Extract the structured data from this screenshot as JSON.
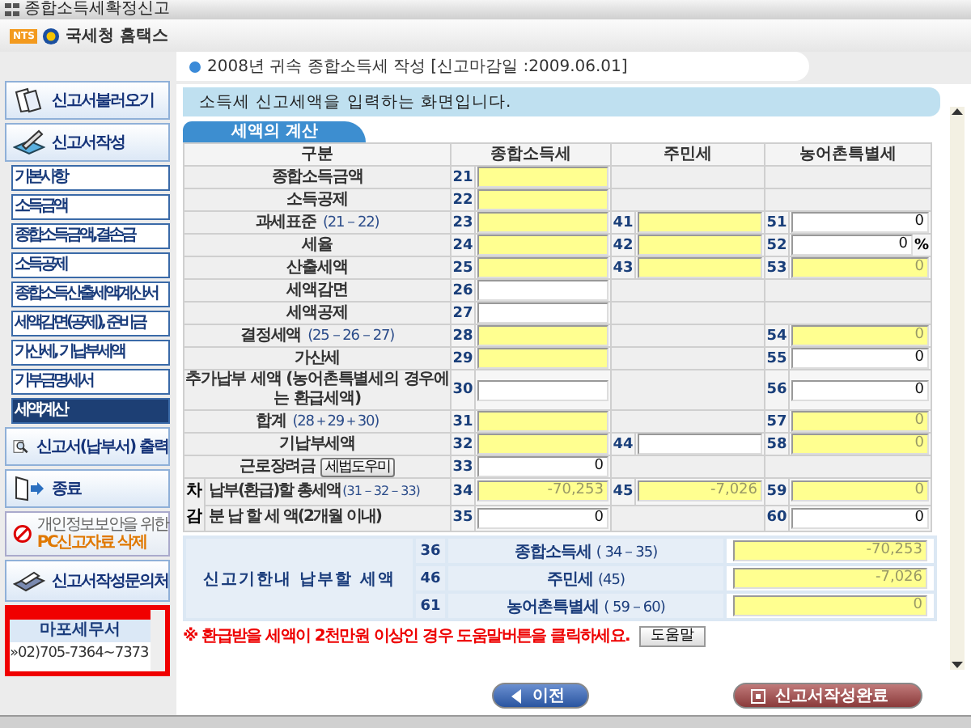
{
  "window": {
    "title": "종합소득세확정신고"
  },
  "header": {
    "logo": "NTS",
    "title": "국세청 홈택스"
  },
  "subheader": "2008년 귀속 종합소득세 작성 [신고마감일 :2009.06.01]",
  "sidebar": {
    "top": [
      {
        "label": "신고서불러오기"
      },
      {
        "label": "신고서작성"
      }
    ],
    "menu": [
      {
        "label": "기본사항",
        "selected": false
      },
      {
        "label": "소득금액",
        "selected": false
      },
      {
        "label": "종합소득금액,결손금",
        "selected": false
      },
      {
        "label": "소득공제",
        "selected": false
      },
      {
        "label": "종합소득산출세액계산서",
        "selected": false
      },
      {
        "label": "세액감면(공제), 준비금",
        "selected": false
      },
      {
        "label": "가산세, 기납부세액",
        "selected": false
      },
      {
        "label": "기부금명세서",
        "selected": false
      },
      {
        "label": "세액계산",
        "selected": true
      }
    ],
    "bottom": [
      {
        "label": "신고서(납부서) 출력"
      },
      {
        "label": "종료"
      }
    ],
    "notice": {
      "line1": "개인정보보안을 위한",
      "line2": "PC신고자료 삭제"
    },
    "contact_button": "신고서작성문의처",
    "contact": {
      "office": "마포세무서",
      "phone": "»02)705-7364~7373"
    }
  },
  "banner": "소득세 신고세액을 입력하는 화면입니다.",
  "tab": "세액의 계산",
  "columns": [
    "구분",
    "종합소득세",
    "주민세",
    "농어촌특별세"
  ],
  "rows": [
    {
      "label": "종합소득금액",
      "cells": [
        {
          "code": "21",
          "highlighted": true
        },
        null,
        null
      ]
    },
    {
      "label": "소득공제",
      "cells": [
        {
          "code": "22",
          "highlighted": true
        },
        null,
        null
      ]
    },
    {
      "label": "과세표준",
      "formula": "(21－22)",
      "cells": [
        {
          "code": "23",
          "highlighted": true
        },
        {
          "code": "41",
          "highlighted": true
        },
        {
          "code": "51",
          "highlighted": false,
          "value": "0"
        }
      ]
    },
    {
      "label": "세율",
      "cells": [
        {
          "code": "24",
          "highlighted": true
        },
        {
          "code": "42",
          "highlighted": true
        },
        {
          "code": "52",
          "highlighted": false,
          "value": "0",
          "suffix": "%"
        }
      ]
    },
    {
      "label": "산출세액",
      "cells": [
        {
          "code": "25",
          "highlighted": true
        },
        {
          "code": "43",
          "highlighted": true
        },
        {
          "code": "53",
          "highlighted": true,
          "value": "0"
        }
      ]
    },
    {
      "label": "세액감면",
      "cells": [
        {
          "code": "26",
          "highlighted": false
        },
        null,
        null
      ]
    },
    {
      "label": "세액공제",
      "cells": [
        {
          "code": "27",
          "highlighted": false
        },
        null,
        null
      ]
    },
    {
      "label": "결정세액",
      "formula": "(25－26－27)",
      "cells": [
        {
          "code": "28",
          "highlighted": true
        },
        null,
        {
          "code": "54",
          "highlighted": true,
          "value": "0"
        }
      ]
    },
    {
      "label": "가산세",
      "cells": [
        {
          "code": "29",
          "highlighted": true
        },
        null,
        {
          "code": "55",
          "highlighted": false,
          "value": "0"
        }
      ]
    },
    {
      "label": "추가납부 세액 (농어촌특별세의 경우에는 환급세액)",
      "cells": [
        {
          "code": "30",
          "highlighted": false
        },
        null,
        {
          "code": "56",
          "highlighted": false,
          "value": "0"
        }
      ]
    },
    {
      "label": "합계",
      "formula": "(28＋29＋30)",
      "cells": [
        {
          "code": "31",
          "highlighted": true
        },
        null,
        {
          "code": "57",
          "highlighted": true,
          "value": "0"
        }
      ]
    },
    {
      "label": "기납부세액",
      "cells": [
        {
          "code": "32",
          "highlighted": true
        },
        {
          "code": "44",
          "highlighted": false
        },
        {
          "code": "58",
          "highlighted": true,
          "value": "0"
        }
      ]
    },
    {
      "label": "근로장려금",
      "helper_button": "세법도우미",
      "cells": [
        {
          "code": "33",
          "highlighted": false,
          "value": "0"
        },
        null,
        null
      ]
    }
  ],
  "deduction": {
    "label": "차감",
    "rows": [
      {
        "label": "납부(환급)할 총세액",
        "formula": "(31－32－33)",
        "cells": [
          {
            "code": "34",
            "highlighted": true,
            "value": "-70,253"
          },
          {
            "code": "45",
            "highlighted": true,
            "value": "-7,026"
          },
          {
            "code": "59",
            "highlighted": true,
            "value": "0"
          }
        ]
      },
      {
        "label": "분 납 할  세 액(2개월 이내)",
        "cells": [
          {
            "code": "35",
            "highlighted": false,
            "value": "0"
          },
          null,
          {
            "code": "60",
            "highlighted": false,
            "value": "0"
          }
        ]
      }
    ]
  },
  "summary": {
    "label": "신고기한내 납부할 세액",
    "rows": [
      {
        "code": "36",
        "label": "종합소득세",
        "formula": "( 34－35)",
        "value": "-70,253",
        "highlighted": true
      },
      {
        "code": "46",
        "label": "주민세",
        "formula": "(45)",
        "value": "-7,026",
        "highlighted": true
      },
      {
        "code": "61",
        "label": "농어촌특별세",
        "formula": "( 59－60)",
        "value": "0",
        "highlighted": true
      }
    ]
  },
  "note": "※ 환급받을 세액이 2천만원 이상인 경우 도움말버튼을 클릭하세요.",
  "help_button": "도움말",
  "buttons": {
    "back": "이전",
    "finish": "신고서작성완료"
  }
}
